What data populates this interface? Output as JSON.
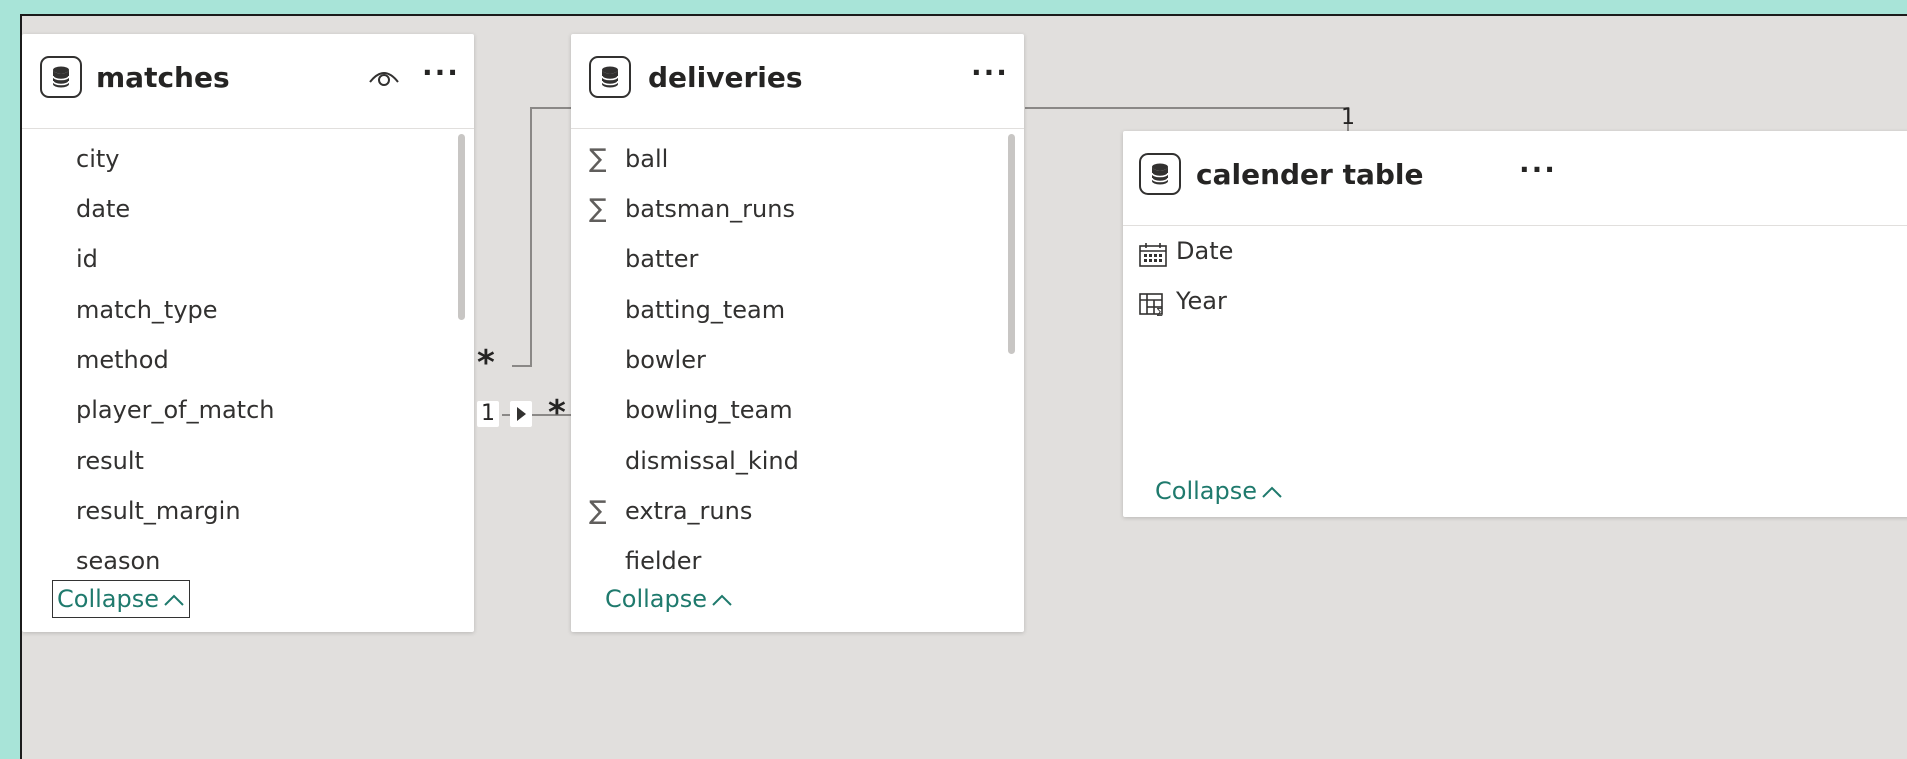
{
  "tables": {
    "matches": {
      "title": "matches",
      "fields": [
        "city",
        "date",
        "id",
        "match_type",
        "method",
        "player_of_match",
        "result",
        "result_margin",
        "season"
      ],
      "collapse_label": "Collapse"
    },
    "deliveries": {
      "title": "deliveries",
      "fields": [
        {
          "name": "ball",
          "sigma": "∑"
        },
        {
          "name": "batsman_runs",
          "sigma": "∑"
        },
        {
          "name": "batter",
          "sigma": ""
        },
        {
          "name": "batting_team",
          "sigma": ""
        },
        {
          "name": "bowler",
          "sigma": ""
        },
        {
          "name": "bowling_team",
          "sigma": ""
        },
        {
          "name": "dismissal_kind",
          "sigma": ""
        },
        {
          "name": "extra_runs",
          "sigma": "∑"
        },
        {
          "name": "fielder",
          "sigma": ""
        }
      ],
      "collapse_label": "Collapse"
    },
    "calender": {
      "title": "calender table",
      "fields": [
        {
          "name": "Date",
          "icon": "calendar-icon"
        },
        {
          "name": "Year",
          "icon": "calculated-column-icon"
        }
      ],
      "collapse_label": "Collapse"
    }
  },
  "relationships": {
    "matches_deliveries_many": "*",
    "matches_deliveries_one": "1",
    "matches_deliveries_many_right": "*",
    "deliveries_calender_one": "1"
  },
  "icons": {
    "table": "database-icon",
    "more": "more-options-icon",
    "visibility": "eye-icon",
    "collapse": "chevron-up-icon",
    "filter_direction": "arrow-right-icon"
  },
  "colors": {
    "background": "#a8e4d8",
    "canvas": "#e1dfdd",
    "collapse_text": "#1f7a6d",
    "line": "#8a8886"
  }
}
